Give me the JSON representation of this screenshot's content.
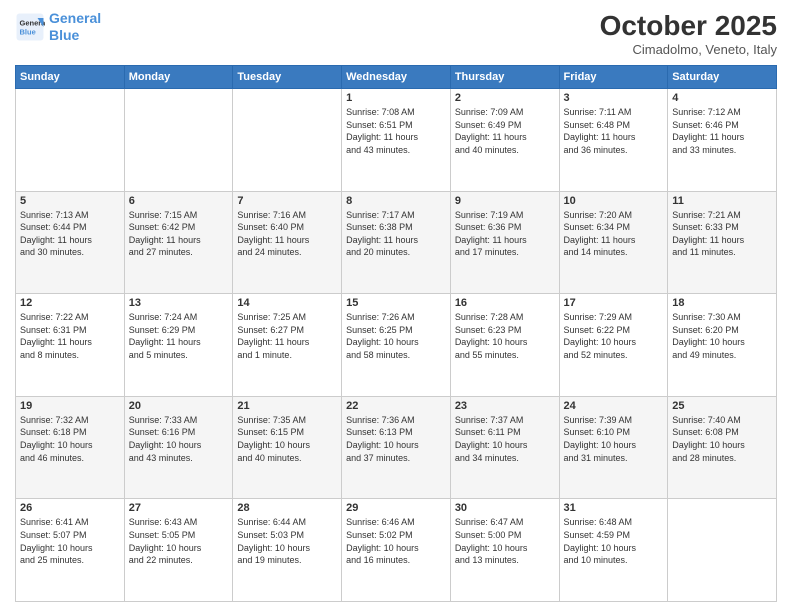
{
  "header": {
    "logo_line1": "General",
    "logo_line2": "Blue",
    "month_title": "October 2025",
    "location": "Cimadolmo, Veneto, Italy"
  },
  "weekdays": [
    "Sunday",
    "Monday",
    "Tuesday",
    "Wednesday",
    "Thursday",
    "Friday",
    "Saturday"
  ],
  "weeks": [
    [
      {
        "day": "",
        "info": ""
      },
      {
        "day": "",
        "info": ""
      },
      {
        "day": "",
        "info": ""
      },
      {
        "day": "1",
        "info": "Sunrise: 7:08 AM\nSunset: 6:51 PM\nDaylight: 11 hours\nand 43 minutes."
      },
      {
        "day": "2",
        "info": "Sunrise: 7:09 AM\nSunset: 6:49 PM\nDaylight: 11 hours\nand 40 minutes."
      },
      {
        "day": "3",
        "info": "Sunrise: 7:11 AM\nSunset: 6:48 PM\nDaylight: 11 hours\nand 36 minutes."
      },
      {
        "day": "4",
        "info": "Sunrise: 7:12 AM\nSunset: 6:46 PM\nDaylight: 11 hours\nand 33 minutes."
      }
    ],
    [
      {
        "day": "5",
        "info": "Sunrise: 7:13 AM\nSunset: 6:44 PM\nDaylight: 11 hours\nand 30 minutes."
      },
      {
        "day": "6",
        "info": "Sunrise: 7:15 AM\nSunset: 6:42 PM\nDaylight: 11 hours\nand 27 minutes."
      },
      {
        "day": "7",
        "info": "Sunrise: 7:16 AM\nSunset: 6:40 PM\nDaylight: 11 hours\nand 24 minutes."
      },
      {
        "day": "8",
        "info": "Sunrise: 7:17 AM\nSunset: 6:38 PM\nDaylight: 11 hours\nand 20 minutes."
      },
      {
        "day": "9",
        "info": "Sunrise: 7:19 AM\nSunset: 6:36 PM\nDaylight: 11 hours\nand 17 minutes."
      },
      {
        "day": "10",
        "info": "Sunrise: 7:20 AM\nSunset: 6:34 PM\nDaylight: 11 hours\nand 14 minutes."
      },
      {
        "day": "11",
        "info": "Sunrise: 7:21 AM\nSunset: 6:33 PM\nDaylight: 11 hours\nand 11 minutes."
      }
    ],
    [
      {
        "day": "12",
        "info": "Sunrise: 7:22 AM\nSunset: 6:31 PM\nDaylight: 11 hours\nand 8 minutes."
      },
      {
        "day": "13",
        "info": "Sunrise: 7:24 AM\nSunset: 6:29 PM\nDaylight: 11 hours\nand 5 minutes."
      },
      {
        "day": "14",
        "info": "Sunrise: 7:25 AM\nSunset: 6:27 PM\nDaylight: 11 hours\nand 1 minute."
      },
      {
        "day": "15",
        "info": "Sunrise: 7:26 AM\nSunset: 6:25 PM\nDaylight: 10 hours\nand 58 minutes."
      },
      {
        "day": "16",
        "info": "Sunrise: 7:28 AM\nSunset: 6:23 PM\nDaylight: 10 hours\nand 55 minutes."
      },
      {
        "day": "17",
        "info": "Sunrise: 7:29 AM\nSunset: 6:22 PM\nDaylight: 10 hours\nand 52 minutes."
      },
      {
        "day": "18",
        "info": "Sunrise: 7:30 AM\nSunset: 6:20 PM\nDaylight: 10 hours\nand 49 minutes."
      }
    ],
    [
      {
        "day": "19",
        "info": "Sunrise: 7:32 AM\nSunset: 6:18 PM\nDaylight: 10 hours\nand 46 minutes."
      },
      {
        "day": "20",
        "info": "Sunrise: 7:33 AM\nSunset: 6:16 PM\nDaylight: 10 hours\nand 43 minutes."
      },
      {
        "day": "21",
        "info": "Sunrise: 7:35 AM\nSunset: 6:15 PM\nDaylight: 10 hours\nand 40 minutes."
      },
      {
        "day": "22",
        "info": "Sunrise: 7:36 AM\nSunset: 6:13 PM\nDaylight: 10 hours\nand 37 minutes."
      },
      {
        "day": "23",
        "info": "Sunrise: 7:37 AM\nSunset: 6:11 PM\nDaylight: 10 hours\nand 34 minutes."
      },
      {
        "day": "24",
        "info": "Sunrise: 7:39 AM\nSunset: 6:10 PM\nDaylight: 10 hours\nand 31 minutes."
      },
      {
        "day": "25",
        "info": "Sunrise: 7:40 AM\nSunset: 6:08 PM\nDaylight: 10 hours\nand 28 minutes."
      }
    ],
    [
      {
        "day": "26",
        "info": "Sunrise: 6:41 AM\nSunset: 5:07 PM\nDaylight: 10 hours\nand 25 minutes."
      },
      {
        "day": "27",
        "info": "Sunrise: 6:43 AM\nSunset: 5:05 PM\nDaylight: 10 hours\nand 22 minutes."
      },
      {
        "day": "28",
        "info": "Sunrise: 6:44 AM\nSunset: 5:03 PM\nDaylight: 10 hours\nand 19 minutes."
      },
      {
        "day": "29",
        "info": "Sunrise: 6:46 AM\nSunset: 5:02 PM\nDaylight: 10 hours\nand 16 minutes."
      },
      {
        "day": "30",
        "info": "Sunrise: 6:47 AM\nSunset: 5:00 PM\nDaylight: 10 hours\nand 13 minutes."
      },
      {
        "day": "31",
        "info": "Sunrise: 6:48 AM\nSunset: 4:59 PM\nDaylight: 10 hours\nand 10 minutes."
      },
      {
        "day": "",
        "info": ""
      }
    ]
  ]
}
